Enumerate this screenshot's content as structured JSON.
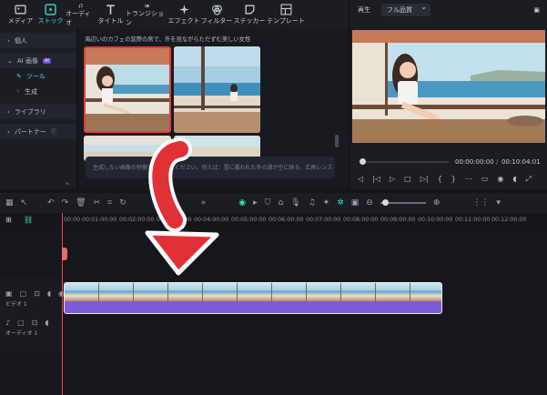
{
  "toolbar": {
    "items": [
      {
        "label": "メディア",
        "icon": "media-icon"
      },
      {
        "label": "ストック",
        "icon": "stock-icon",
        "active": true
      },
      {
        "label": "オーディオ",
        "icon": "audio-icon"
      },
      {
        "label": "タイトル",
        "icon": "title-icon"
      },
      {
        "label": "トランジション",
        "icon": "transition-icon"
      },
      {
        "label": "エフェクト",
        "icon": "effect-icon"
      },
      {
        "label": "フィルター",
        "icon": "filter-icon"
      },
      {
        "label": "ステッカー",
        "icon": "sticker-icon"
      },
      {
        "label": "テンプレート",
        "icon": "template-icon"
      }
    ]
  },
  "sidebar": {
    "items": [
      {
        "label": "個人"
      },
      {
        "label": "AI 画像",
        "badge": "AI"
      },
      {
        "label": "ツール"
      },
      {
        "label": "生成"
      },
      {
        "label": "ライブラリ"
      },
      {
        "label": "パートナー"
      }
    ]
  },
  "content": {
    "description": "海辺いのカフェの窓際の席で、外を見ながらただずむ美しい女性",
    "prompt_placeholder": "生成したい画像の特徴を入力してください。例えば：雪に覆われた冬の湖が空に映る、広角レンズ"
  },
  "preview": {
    "label": "再生",
    "quality": "フル品質",
    "current_time": "00:00:00:00",
    "total_time": "00:10:04:01"
  },
  "timeline": {
    "ruler": [
      "00:00",
      "00:01:00:00",
      "00:02:00:00",
      "00:03:00:00",
      "00:04:00:00",
      "00:05:00:00",
      "00:06:00:00",
      "00:07:00:00",
      "00:08:00:00",
      "00:09:00:00",
      "00:10:00:00",
      "00:11:00:00",
      "00:12:00:00"
    ],
    "video_track": "ビデオ 1",
    "audio_track": "オーディオ 1"
  },
  "colors": {
    "accent": "#3de0c8",
    "arrow": "#e03236",
    "clip": "#7c5ad8"
  }
}
